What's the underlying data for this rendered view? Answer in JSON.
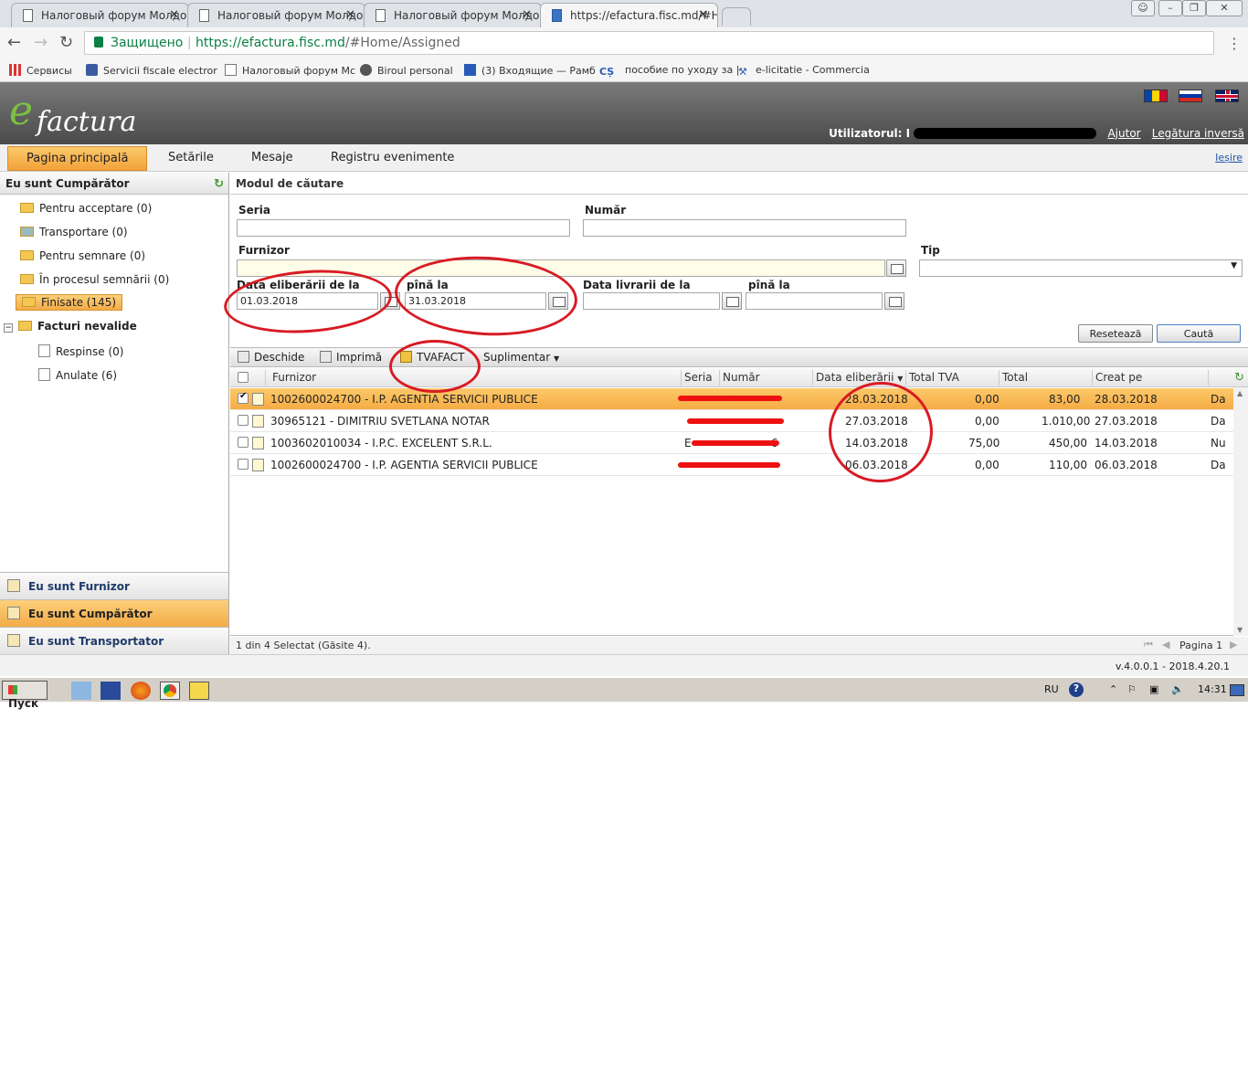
{
  "browser": {
    "tabs": [
      {
        "label": "Налоговый форум Молдов"
      },
      {
        "label": "Налоговый форум Молдов"
      },
      {
        "label": "Налоговый форум Молдов"
      },
      {
        "label": "https://efactura.fisc.md/#H"
      }
    ],
    "secure_label": "Защищено",
    "url_main": "https://efactura.fisc.md",
    "url_rest": "/#Home/Assigned",
    "bookmarks": [
      {
        "label": "Сервисы",
        "icon": "apps-grid-icon"
      },
      {
        "label": "Servicii fiscale electror",
        "icon": "crest-icon"
      },
      {
        "label": "Налоговый форум Мс",
        "icon": "page-icon"
      },
      {
        "label": "Biroul personal",
        "icon": "globe-icon"
      },
      {
        "label": "(3) Входящие — Рамб",
        "icon": "mail-icon"
      },
      {
        "label": "пособие по уходу за |",
        "icon": "cs-icon"
      },
      {
        "label": "e-licitatie - Commercia",
        "icon": "hammer-icon"
      }
    ]
  },
  "app": {
    "logo_e": "e",
    "logo_rest": "factura",
    "user_label": "Utilizatorul:",
    "user_value": "I",
    "help_link": "Ajutor",
    "feedback_link": "Legătura inversă",
    "logout_link": "Ieșire",
    "menu": [
      {
        "label": "Pagina principală",
        "active": true
      },
      {
        "label": "Setările"
      },
      {
        "label": "Mesaje"
      },
      {
        "label": "Registru evenimente"
      }
    ]
  },
  "left": {
    "header": "Eu sunt Cumpărător",
    "items": [
      {
        "label": "Pentru acceptare (0)"
      },
      {
        "label": "Transportare (0)"
      },
      {
        "label": "Pentru semnare (0)"
      },
      {
        "label": "În procesul semnării (0)"
      },
      {
        "label": "Finisate (145)"
      },
      {
        "label": "Facturi nevalide"
      },
      {
        "label": "Respinse (0)"
      },
      {
        "label": "Anulate (6)"
      }
    ],
    "bottom_tabs": [
      {
        "label": "Eu sunt Furnizor"
      },
      {
        "label": "Eu sunt Cumpărător"
      },
      {
        "label": "Eu sunt Transportator"
      }
    ]
  },
  "search": {
    "title": "Modul de căutare",
    "seria_label": "Seria",
    "numar_label": "Număr",
    "furnizor_label": "Furnizor",
    "tip_label": "Tip",
    "data_elib_from_label": "Data eliberării de la",
    "data_elib_from_value": "01.03.2018",
    "data_elib_to_label": "pînă la",
    "data_elib_to_value": "31.03.2018",
    "data_livr_from_label": "Data livrarii de la",
    "data_livr_to_label": "pînă la",
    "reset_label": "Resetează",
    "search_label": "Caută"
  },
  "toolbar": {
    "open": "Deschide",
    "print": "Imprimă",
    "tvafact": "TVAFACT",
    "more": "Suplimentar"
  },
  "grid": {
    "columns": [
      "Furnizor",
      "Seria",
      "Număr",
      "Data eliberării",
      "Total TVA",
      "Total",
      "Creat pe"
    ],
    "rows": [
      {
        "furnizor": "1002600024700 - I.P. AGENTIA SERVICII PUBLICE",
        "seria": "",
        "numar": "",
        "data": "28.03.2018",
        "tva": "0,00",
        "total": "83,00",
        "creat": "28.03.2018",
        "flag": "Da",
        "selected": true
      },
      {
        "furnizor": "30965121 - DIMITRIU SVETLANA NOTAR",
        "seria": "",
        "numar": "",
        "data": "27.03.2018",
        "tva": "0,00",
        "total": "1.010,00",
        "creat": "27.03.2018",
        "flag": "Da"
      },
      {
        "furnizor": "1003602010034 - I.P.C. EXCELENT S.R.L.",
        "seria": "E",
        "numar": "6",
        "data": "14.03.2018",
        "tva": "75,00",
        "total": "450,00",
        "creat": "14.03.2018",
        "flag": "Nu"
      },
      {
        "furnizor": "1002600024700 - I.P. AGENTIA SERVICII PUBLICE",
        "seria": "",
        "numar": "",
        "data": "06.03.2018",
        "tva": "0,00",
        "total": "110,00",
        "creat": "06.03.2018",
        "flag": "Da"
      }
    ],
    "status": "1 din 4 Selectat (Găsite 4).",
    "page": "Pagina 1"
  },
  "version": "v.4.0.0.1 - 2018.4.20.1",
  "taskbar": {
    "start": "Пуск",
    "lang": "RU",
    "time": "14:31"
  },
  "colors": {
    "accent": "#f3ab48",
    "annotation": "#d81b24",
    "header": "#5a5a5a"
  }
}
